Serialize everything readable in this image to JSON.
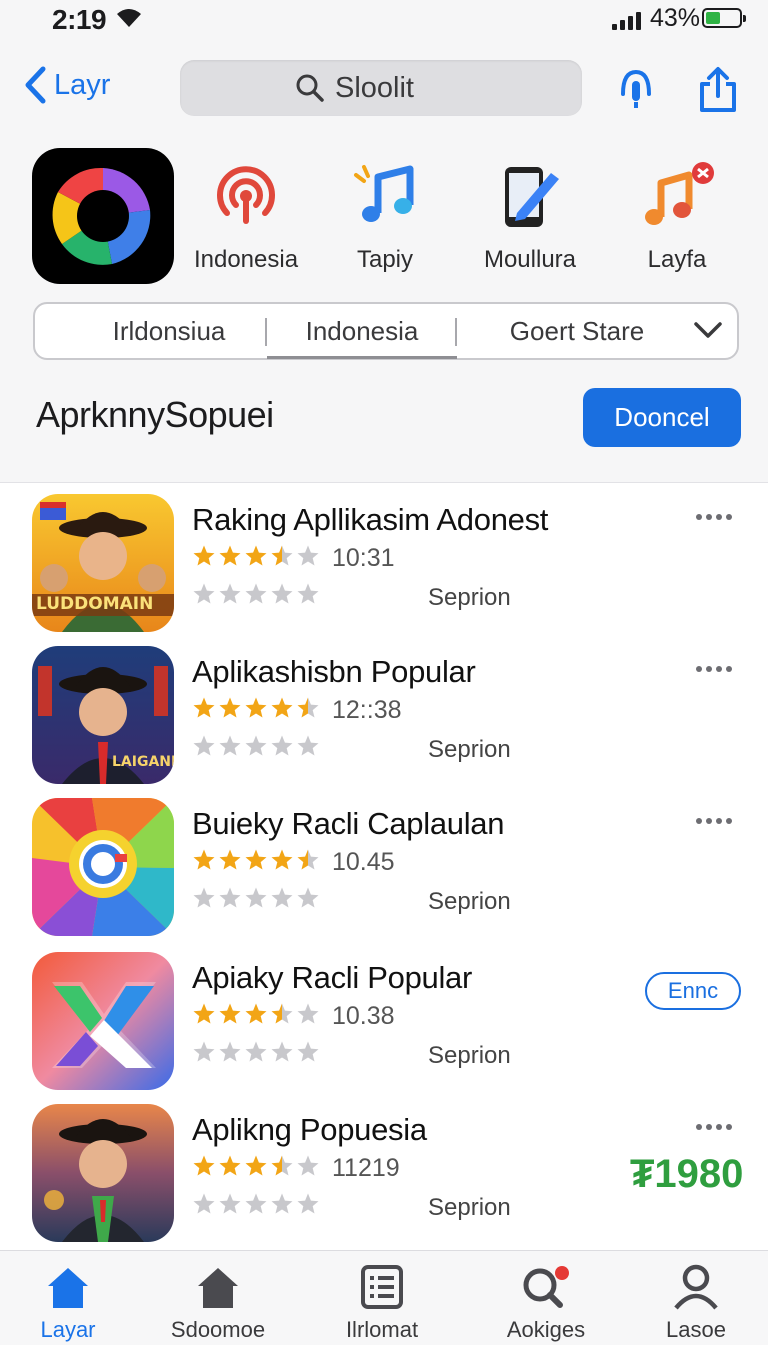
{
  "status": {
    "time": "2:19",
    "battery": "43%",
    "battery_level": 0.43
  },
  "nav": {
    "back_label": "Layr",
    "search_placeholder": "Sloolit"
  },
  "categories": [
    {
      "label": "Indonesia",
      "icon": "podcast-signal-icon"
    },
    {
      "label": "Tapiy",
      "icon": "music-note-icon"
    },
    {
      "label": "Moullura",
      "icon": "phone-pen-icon"
    },
    {
      "label": "Layfa",
      "icon": "music-note-badge-icon"
    }
  ],
  "segments": [
    {
      "label": "Irldonsiua"
    },
    {
      "label": "Indonesia",
      "active": true
    },
    {
      "label": "Goert Stare"
    }
  ],
  "section": {
    "title": "AprknnySopuei",
    "button": "Dooncel"
  },
  "apps": [
    {
      "name": "Raking Apllikasim Adonest",
      "time": "10:31",
      "sub": "Seprion",
      "rating": 3.5,
      "icon_text": "LUDDOMAIN",
      "action": "more"
    },
    {
      "name": "Aplikashisbn Popular",
      "time": "12::38",
      "sub": "Seprion",
      "rating": 4.5,
      "icon_text": "LAIGANI",
      "action": "more"
    },
    {
      "name": "Buieky Racli Caplaulan",
      "time": "10.45",
      "sub": "Seprion",
      "rating": 4.5,
      "icon_text": "",
      "action": "more"
    },
    {
      "name": "Apiaky Racli Popular",
      "time": "10.38",
      "sub": "Seprion",
      "rating": 3.5,
      "icon_text": "",
      "action": "get",
      "action_label": "Ennc"
    },
    {
      "name": "Aplikng Popuesia",
      "time": "11219",
      "sub": "Seprion",
      "rating": 3.5,
      "icon_text": "",
      "action": "more",
      "price": "₮1980"
    }
  ],
  "tabs": [
    {
      "label": "Layar",
      "icon": "home-icon",
      "active": true
    },
    {
      "label": "Sdoomoe",
      "icon": "home-icon",
      "active": false
    },
    {
      "label": "Ilrlomat",
      "icon": "list-icon",
      "active": false
    },
    {
      "label": "Aokiges",
      "icon": "search-icon",
      "active": false
    },
    {
      "label": "Lasoe",
      "icon": "profile-icon",
      "active": false
    }
  ],
  "colors": {
    "accent": "#1a6fe0",
    "star": "#f2a516",
    "price": "#2f9e3f"
  }
}
